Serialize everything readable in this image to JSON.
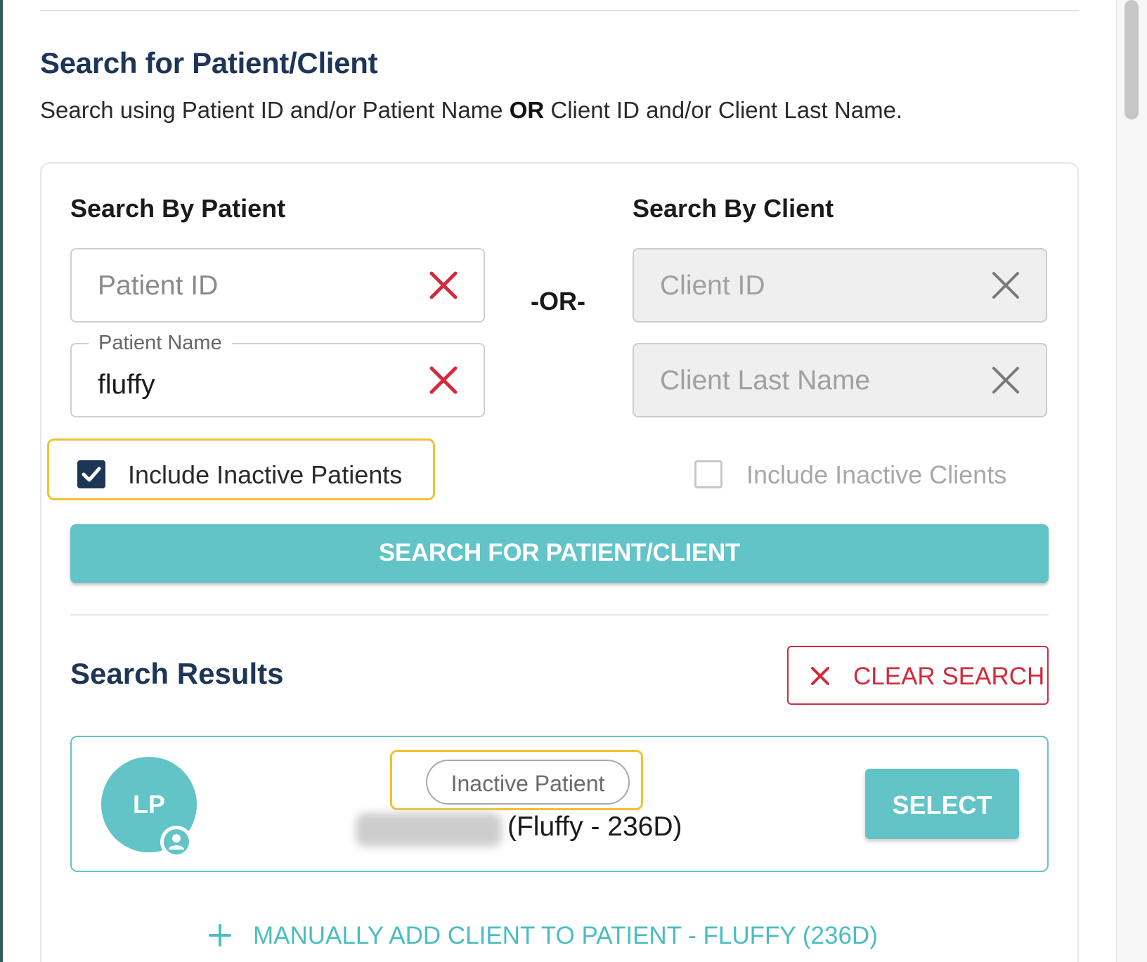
{
  "header": {
    "title": "Search for Patient/Client",
    "subtitle_part1": "Search using Patient ID and/or Patient Name ",
    "subtitle_or": "OR",
    "subtitle_part2": " Client ID and/or Client Last Name."
  },
  "patient_search": {
    "section_label": "Search By Patient",
    "patient_id_placeholder": "Patient ID",
    "patient_name_label": "Patient Name",
    "patient_name_value": "fluffy",
    "include_inactive_label": "Include Inactive Patients",
    "include_inactive_checked": true
  },
  "or_separator": "-OR-",
  "client_search": {
    "section_label": "Search By Client",
    "client_id_placeholder": "Client ID",
    "client_last_name_placeholder": "Client Last Name",
    "include_inactive_label": "Include Inactive Clients",
    "include_inactive_checked": false
  },
  "search_button_label": "SEARCH FOR PATIENT/CLIENT",
  "results": {
    "title": "Search Results",
    "clear_button_label": "CLEAR SEARCH",
    "items": [
      {
        "avatar_initials": "LP",
        "status_badge": "Inactive Patient",
        "patient_info": "(Fluffy - 236D)",
        "select_label": "SELECT"
      }
    ]
  },
  "manual_add_label": "MANUALLY ADD CLIENT TO PATIENT - FLUFFY (236D)",
  "colors": {
    "primary_teal": "#62c4c7",
    "navy": "#1d3557",
    "danger_red": "#d42a3c",
    "highlight_yellow": "#f2c230"
  }
}
